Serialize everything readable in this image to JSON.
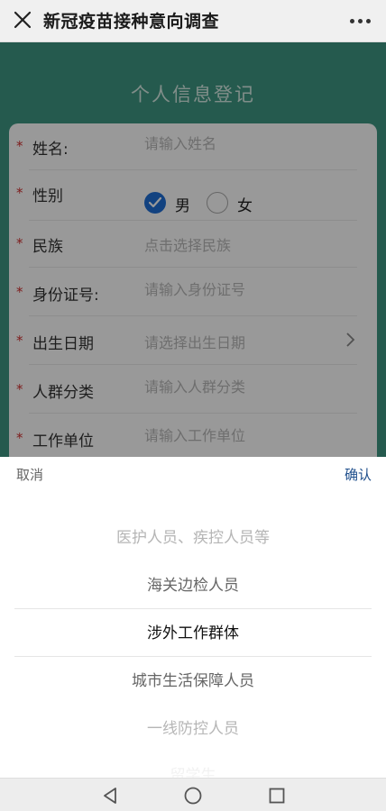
{
  "app": {
    "title": "新冠疫苗接种意向调查",
    "close_icon": "close-icon",
    "more_icon": "more-icon"
  },
  "form": {
    "heading": "个人信息登记",
    "fields": [
      {
        "label": "姓名:",
        "placeholder": "请输入姓名",
        "required": true
      },
      {
        "label": "性别",
        "required": true,
        "options": [
          "男",
          "女"
        ],
        "selected": "男"
      },
      {
        "label": "民族",
        "placeholder": "点击选择民族",
        "required": true
      },
      {
        "label": "身份证号:",
        "placeholder": "请输入身份证号",
        "required": true
      },
      {
        "label": "出生日期",
        "placeholder": "请选择出生日期",
        "required": true
      },
      {
        "label": "人群分类",
        "placeholder": "请输入人群分类",
        "required": true
      },
      {
        "label": "工作单位",
        "placeholder": "请输入工作单位",
        "required": true
      }
    ],
    "required_mark": "*"
  },
  "picker": {
    "cancel_label": "取消",
    "confirm_label": "确认",
    "options": [
      "医护人员、疾控人员等",
      "海关边检人员",
      "涉外工作群体",
      "城市生活保障人员",
      "一线防控人员",
      "留学生"
    ],
    "selected": "涉外工作群体"
  },
  "colors": {
    "header_bg": "#3f9783",
    "accent_blue": "#1f6fd6",
    "required_red": "#d23030",
    "confirm_blue": "#1f4f8c"
  },
  "system_nav": {
    "icons": [
      "back-triangle-icon",
      "home-circle-icon",
      "recents-square-icon"
    ]
  }
}
